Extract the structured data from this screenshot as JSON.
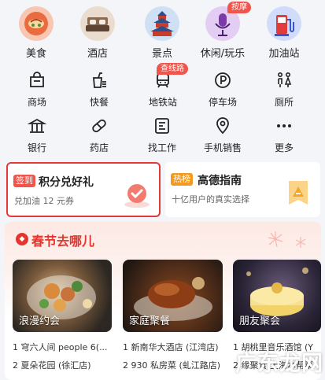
{
  "top_categories": [
    {
      "label": "美食",
      "icon": "food-icon"
    },
    {
      "label": "酒店",
      "icon": "hotel-icon"
    },
    {
      "label": "景点",
      "icon": "temple-icon"
    },
    {
      "label": "休闲/玩乐",
      "icon": "microphone-icon",
      "badge": "按摩"
    },
    {
      "label": "加油站",
      "icon": "fuel-pump-icon"
    }
  ],
  "grid_row1": [
    {
      "label": "商场",
      "icon": "shopping-bag-icon"
    },
    {
      "label": "快餐",
      "icon": "fast-food-icon"
    },
    {
      "label": "地铁站",
      "icon": "subway-icon",
      "badge": "查线路"
    },
    {
      "label": "停车场",
      "icon": "parking-icon"
    },
    {
      "label": "厕所",
      "icon": "restroom-icon"
    }
  ],
  "grid_row2": [
    {
      "label": "银行",
      "icon": "bank-icon"
    },
    {
      "label": "药店",
      "icon": "pill-icon"
    },
    {
      "label": "找工作",
      "icon": "job-icon"
    },
    {
      "label": "手机销售",
      "icon": "location-pin-icon"
    },
    {
      "label": "更多",
      "icon": "more-icon"
    }
  ],
  "promo_left": {
    "tag": "签到",
    "title": "积分兑好礼",
    "subtitle": "兑加油 12 元券"
  },
  "promo_right": {
    "tag": "热榜",
    "title": "高德指南",
    "subtitle": "十亿用户的真实选择"
  },
  "section": {
    "title": "春节去哪儿",
    "cards": [
      {
        "caption": "浪漫约会",
        "items": [
          "1 穹六人间 people 6(...",
          "2 夏朵花园 (徐汇店)"
        ]
      },
      {
        "caption": "家庭聚餐",
        "items": [
          "1 新南华大酒店 (江湾店)",
          "2 930 私房菜 (虬江路店)"
        ]
      },
      {
        "caption": "朋友聚会",
        "items": [
          "1 胡桃里音乐酒馆 (Y",
          "2 缘聚食·上海本帮菜"
        ]
      }
    ]
  },
  "watermark": "广东龙网",
  "colors": {
    "brand_red": "#e2362f",
    "accent_orange": "#f39a1e",
    "page_bg": "#f4f5f9"
  }
}
